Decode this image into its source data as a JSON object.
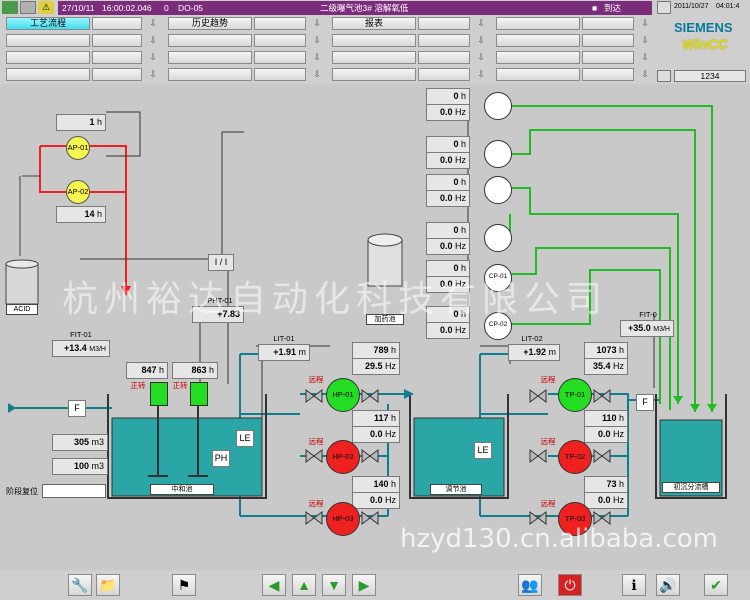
{
  "topbar": {
    "date": "27/10/11",
    "time": "16:00:02.046",
    "alarm_index": "0",
    "alarm_tag": "DO-05",
    "alarm_message": "二级曝气池3# 溶解氧低",
    "alarm_state": "到达",
    "right_date": "2011/10/27",
    "right_time": "04:01:4",
    "user_field": "1234",
    "nav_buttons": [
      "工艺流程",
      "历史趋势",
      "报表"
    ],
    "brand_top": "SIEMENS",
    "brand_bottom": "WinCC"
  },
  "colors": {
    "running": "#22dd22",
    "stopped": "#ee2020",
    "aux_pump": "#f5f550",
    "water": "#2aa6a6",
    "alarm_bar": "#7b2c7b"
  },
  "plant": {
    "acid_pumps": {
      "runtime": "1",
      "runtime_unit": "h",
      "runtime2": "14",
      "runtime2_unit": "h",
      "labels": [
        "AP-01",
        "AP-02"
      ],
      "tank": "ACID"
    },
    "switch_label": "I / I",
    "fit01": {
      "tag": "FIT-01",
      "value": "+13.4",
      "unit": "M3/H"
    },
    "pht01": {
      "tag": "PHT-01",
      "value": "+7.83"
    },
    "lit01": {
      "tag": "LIT-01",
      "value": "+1.91",
      "unit": "m"
    },
    "lit02": {
      "tag": "LIT-02",
      "value": "+1.92",
      "unit": "m"
    },
    "fit0": {
      "tag": "FIT-0",
      "value": "+35.0",
      "unit": "M3/H"
    },
    "mixers": [
      {
        "value": "847",
        "unit": "h"
      },
      {
        "value": "863",
        "unit": "h"
      }
    ],
    "mixer_labels": [
      "正转",
      "正转"
    ],
    "volumes": [
      {
        "value": "305",
        "unit": "m3"
      },
      {
        "value": "100",
        "unit": "m3"
      }
    ],
    "reset_label": "阶段复位",
    "flow_f": "F",
    "ph_label": "PH",
    "le_label": "LE",
    "tanks": [
      "中和池",
      "调节池",
      "初沉分流槽"
    ],
    "dosing_tank": "加药池",
    "blowers": [
      {
        "h": "0",
        "hz": "0.0"
      },
      {
        "h": "0",
        "hz": "0.0"
      },
      {
        "h": "0",
        "hz": "0.0"
      },
      {
        "h": "0",
        "hz": "0.0"
      },
      {
        "h": "0",
        "hz": "0.0"
      },
      {
        "h": "0",
        "hz": "0.0"
      }
    ],
    "blower_labels": [
      "CP-01",
      "CP-02"
    ],
    "hp_pumps": [
      {
        "label": "HP-01",
        "h": "789",
        "hz": "29.5",
        "state": "running"
      },
      {
        "label": "HP-02",
        "h": "117",
        "hz": "0.0",
        "state": "stopped"
      },
      {
        "label": "HP-03",
        "h": "140",
        "hz": "0.0",
        "state": "stopped"
      }
    ],
    "tp_pumps": [
      {
        "label": "TP-01",
        "h": "1073",
        "hz": "35.4",
        "state": "running"
      },
      {
        "label": "TP-02",
        "h": "110",
        "hz": "0.0",
        "state": "stopped"
      },
      {
        "label": "TP-03",
        "h": "73",
        "hz": "0.0",
        "state": "stopped"
      }
    ],
    "pump_tag": "远程",
    "unit_h": "h",
    "unit_hz": "Hz"
  },
  "watermark": {
    "company": "杭州裕达自动化科技有限公司",
    "site": "hzyd130.cn.alibaba.com"
  },
  "bottombar": {
    "icons": [
      "tools-icon",
      "folder-icon",
      "language-icon",
      "arrow-left-icon",
      "arrow-up-icon",
      "arrow-down-icon",
      "arrow-right-icon",
      "users-icon",
      "power-icon",
      "info-icon",
      "speaker-icon",
      "acknowledge-icon"
    ]
  }
}
